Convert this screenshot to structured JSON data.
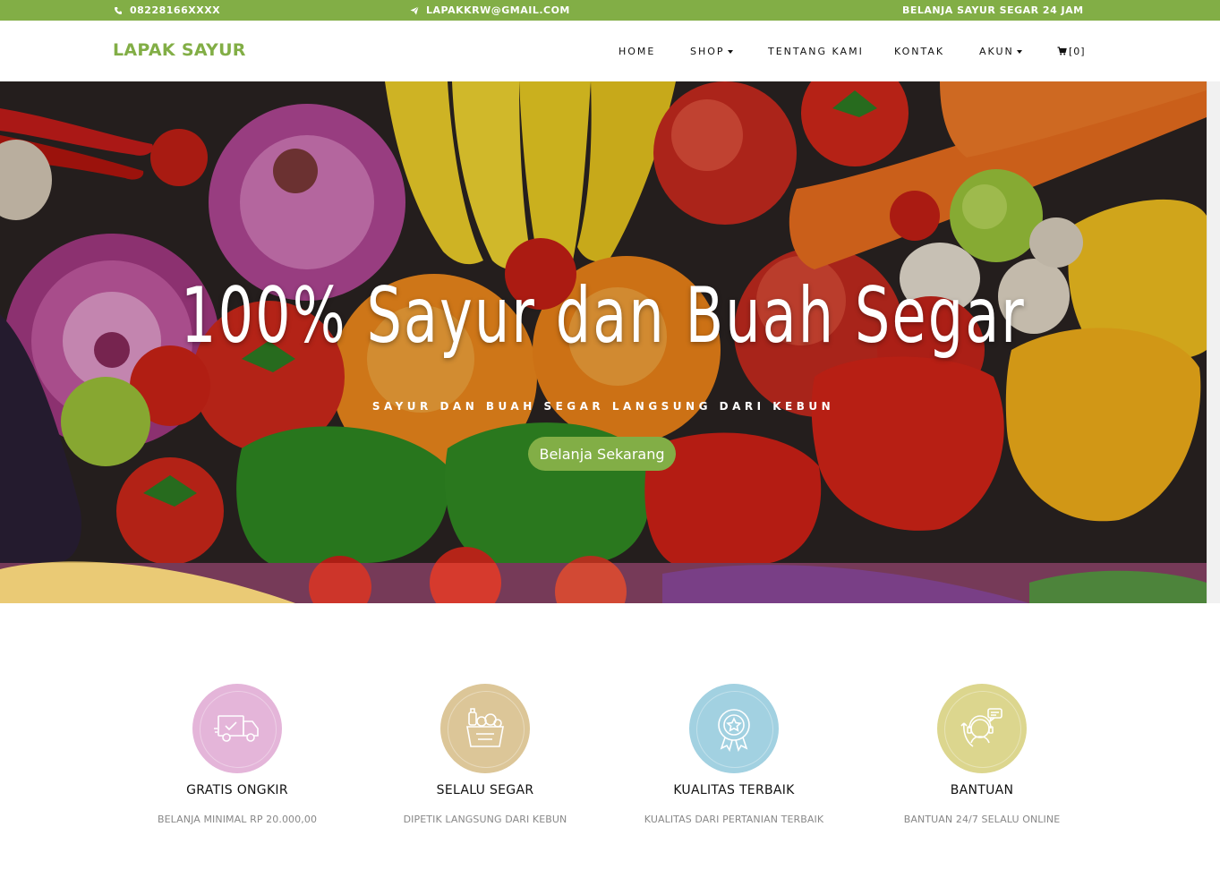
{
  "topbar": {
    "phone": "08228166XXXX",
    "email": "LAPAKKRW@GMAIL.COM",
    "tagline": "BELANJA SAYUR SEGAR 24 JAM"
  },
  "nav": {
    "brand": "LAPAK SAYUR",
    "home": "HOME",
    "shop": "SHOP",
    "about": "TENTANG KAMI",
    "contact": "KONTAK",
    "account": "AKUN",
    "cart": "[0]"
  },
  "hero": {
    "title": "100% Sayur dan Buah Segar",
    "subtitle": "SAYUR DAN BUAH SEGAR LANGSUNG DARI KEBUN",
    "button": "Belanja Sekarang"
  },
  "features": [
    {
      "title": "GRATIS ONGKIR",
      "desc": "BELANJA MINIMAL RP 20.000,00",
      "color": "#e4b5d9",
      "icon": "delivery-truck-icon"
    },
    {
      "title": "SELALU SEGAR",
      "desc": "DIPETIK LANGSUNG DARI KEBUN",
      "color": "#dcc698",
      "icon": "grocery-bag-icon"
    },
    {
      "title": "KUALITAS TERBAIK",
      "desc": "KUALITAS DARI PERTANIAN TERBAIK",
      "color": "#a2d1e1",
      "icon": "award-badge-icon"
    },
    {
      "title": "BANTUAN",
      "desc": "BANTUAN 24/7 SELALU ONLINE",
      "color": "#dcd68e",
      "icon": "support-agent-icon"
    }
  ],
  "colors": {
    "accent": "#82ae46"
  }
}
